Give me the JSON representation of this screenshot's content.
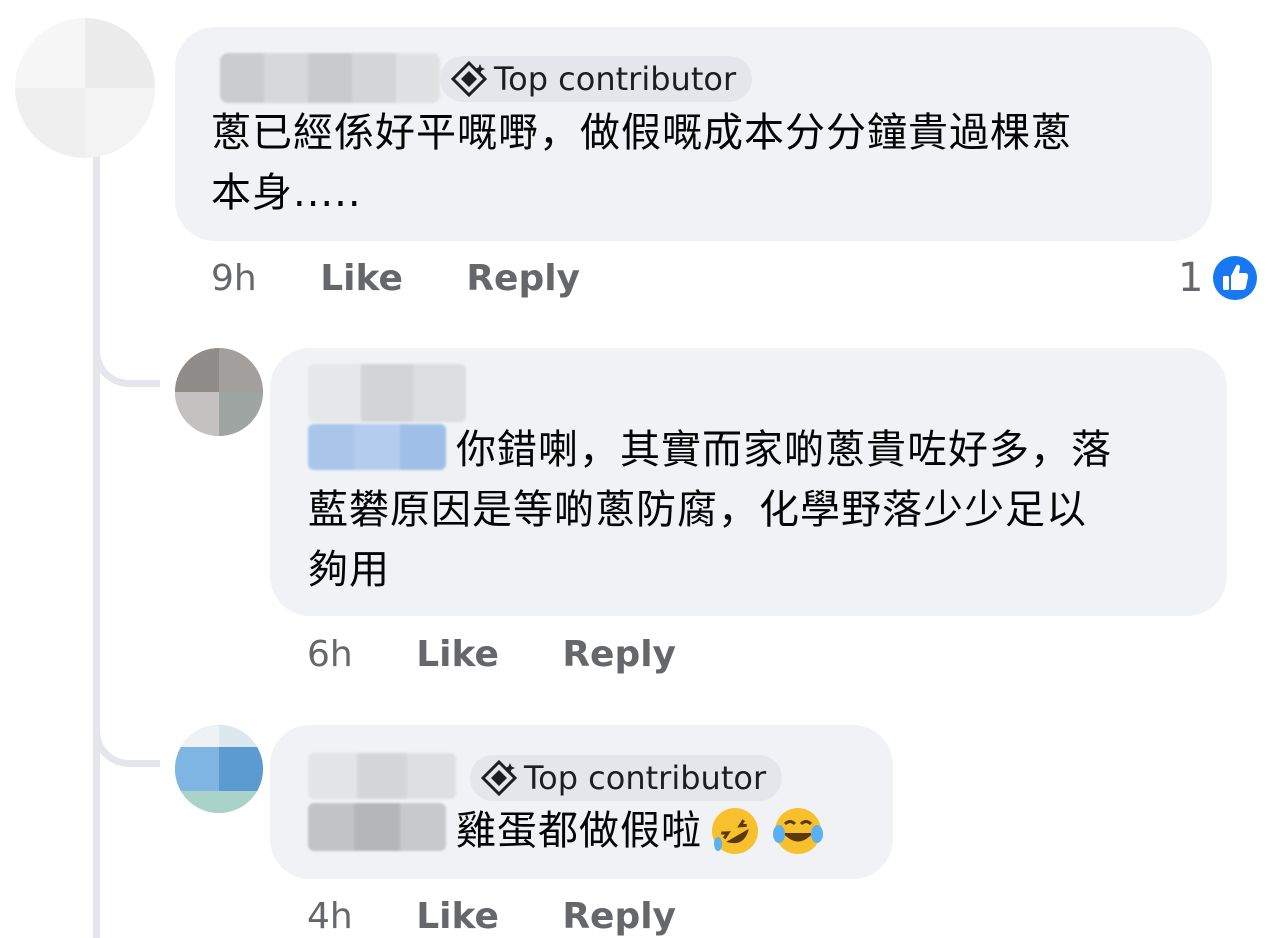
{
  "comments": [
    {
      "badge": "Top contributor",
      "text_line1": "蔥已經係好平嘅嘢，做假嘅成本分分鐘貴過棵蔥",
      "text_line2": "本身.....",
      "time": "9h",
      "like": "Like",
      "reply": "Reply",
      "reaction_count": "1"
    },
    {
      "text_line1": "你錯喇，其實而家啲蔥貴咗好多，落",
      "text_line2": "藍礬原因是等啲蔥防腐，化學野落少少足以",
      "text_line3": "夠用",
      "time": "6h",
      "like": "Like",
      "reply": "Reply"
    },
    {
      "badge": "Top contributor",
      "text": "雞蛋都做假啦",
      "emojis": [
        "rolling-on-floor-laughing",
        "face-with-tears-of-joy"
      ],
      "time": "4h",
      "like": "Like",
      "reply": "Reply"
    }
  ],
  "colors": {
    "bubble": "#f0f2f5",
    "badge": "#e4e6eb",
    "meta": "#65676b",
    "like_blue": "#1877f2"
  }
}
